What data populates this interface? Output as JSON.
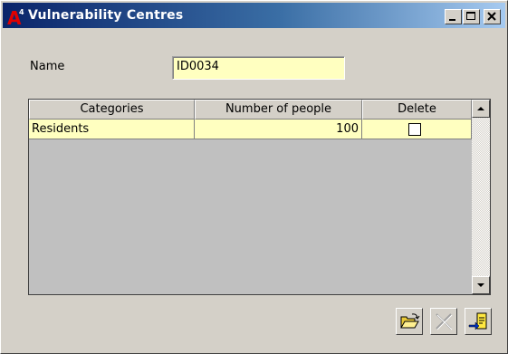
{
  "window": {
    "title": "Vulnerability Centres",
    "logo_letter": "A",
    "logo_superscript": "4",
    "controls": {
      "minimize": "minimize-icon",
      "maximize": "maximize-icon",
      "close": "close-icon"
    }
  },
  "form": {
    "name_label": "Name",
    "name_value": "ID0034"
  },
  "grid": {
    "columns": [
      "Categories",
      "Number of people",
      "Delete"
    ],
    "rows": [
      {
        "category": "Residents",
        "number_of_people": "100",
        "delete": false
      }
    ]
  },
  "toolbar": {
    "open_icon": "open-folder-icon",
    "delete_icon": "delete-x-icon",
    "exit_icon": "exit-icon"
  },
  "colors": {
    "field_bg": "#ffffc0",
    "title_start": "#0a246a",
    "title_end": "#a6caf0",
    "face": "#d4d0c8"
  }
}
